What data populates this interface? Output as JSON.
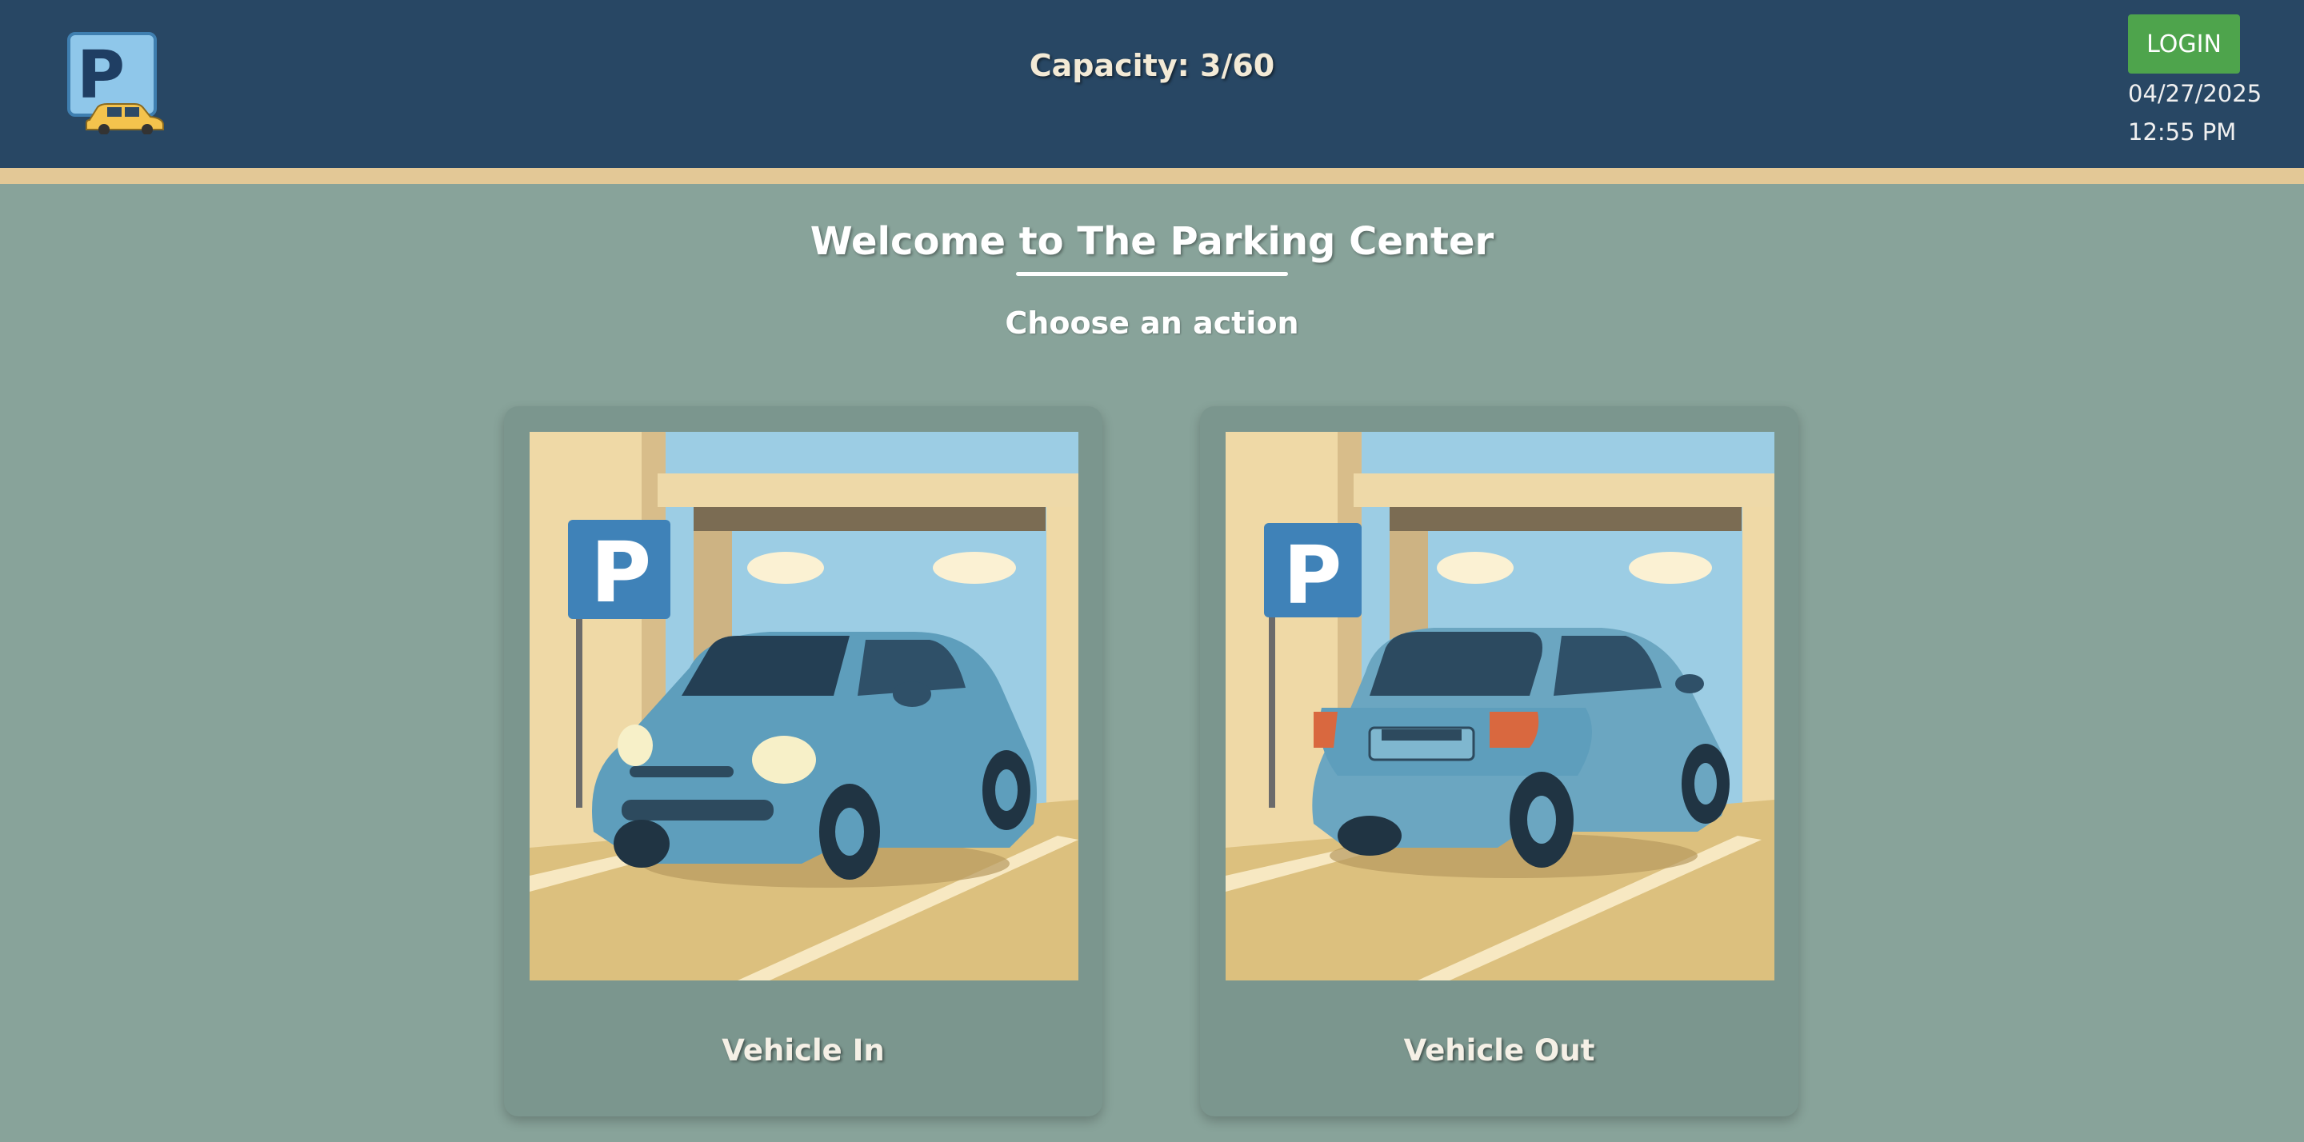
{
  "header": {
    "capacity": "Capacity: 3/60",
    "login_label": "LOGIN",
    "date": "04/27/2025",
    "time": "12:55 PM"
  },
  "main": {
    "title": "Welcome to The Parking Center",
    "subtitle": "Choose an action"
  },
  "actions": [
    {
      "label": "Vehicle In",
      "icon": "car-front-entering-garage"
    },
    {
      "label": "Vehicle Out",
      "icon": "car-rear-exiting-garage"
    }
  ],
  "colors": {
    "header_bg": "#284764",
    "accent_stripe": "#e3c896",
    "page_bg": "#88a39a",
    "card_bg": "#7b968e",
    "login_button": "#4ea44c",
    "parking_sign": "#3f82b8"
  }
}
